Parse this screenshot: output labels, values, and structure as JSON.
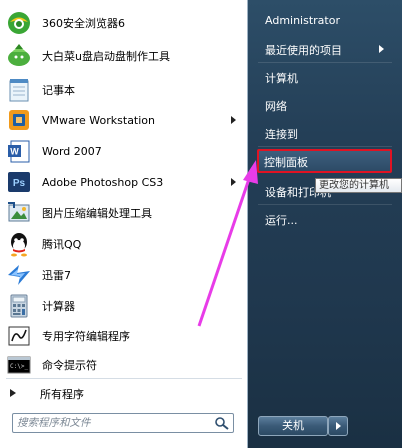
{
  "left_menu": {
    "items": [
      {
        "label": "360安全浏览器6",
        "icon": "browser-360-icon",
        "has_submenu": false
      },
      {
        "label": "大白菜u盘启动盘制作工具",
        "icon": "usb-tool-icon",
        "has_submenu": false
      },
      {
        "label": "记事本",
        "icon": "notepad-icon",
        "has_submenu": false
      },
      {
        "label": "VMware Workstation",
        "icon": "vmware-icon",
        "has_submenu": true
      },
      {
        "label": "Word 2007",
        "icon": "word-icon",
        "has_submenu": false
      },
      {
        "label": "Adobe Photoshop CS3",
        "icon": "photoshop-icon",
        "has_submenu": true
      },
      {
        "label": "图片压缩编辑处理工具",
        "icon": "image-tool-icon",
        "has_submenu": false
      },
      {
        "label": "腾讯QQ",
        "icon": "qq-icon",
        "has_submenu": false
      },
      {
        "label": "迅雷7",
        "icon": "thunder-icon",
        "has_submenu": false
      },
      {
        "label": "计算器",
        "icon": "calculator-icon",
        "has_submenu": false
      },
      {
        "label": "专用字符编辑程序",
        "icon": "char-editor-icon",
        "has_submenu": false
      },
      {
        "label": "命令提示符",
        "icon": "cmd-icon",
        "has_submenu": false
      }
    ],
    "all_programs": "所有程序",
    "search_placeholder": "搜索程序和文件"
  },
  "right_menu": {
    "items": [
      {
        "label": "Administrator",
        "has_submenu": false
      },
      {
        "label": "最近使用的项目",
        "has_submenu": true
      },
      {
        "label": "计算机",
        "has_submenu": false
      },
      {
        "label": "网络",
        "has_submenu": false
      },
      {
        "label": "连接到",
        "has_submenu": false
      },
      {
        "label": "控制面板",
        "has_submenu": false,
        "highlighted": true
      },
      {
        "label": "设备和打印机",
        "has_submenu": false
      },
      {
        "label": "运行...",
        "has_submenu": false
      }
    ],
    "shutdown_label": "关机"
  },
  "tooltip": "更改您的计算机",
  "colors": {
    "highlight_border": "#e01323",
    "annotation_arrow": "#e83ce8",
    "right_panel": "#243f57"
  }
}
